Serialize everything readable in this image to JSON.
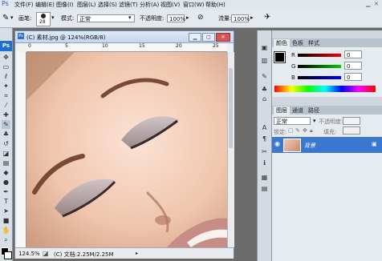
{
  "menu": [
    "文件(F)",
    "编辑(E)",
    "图像(I)",
    "图层(L)",
    "选择(S)",
    "滤镜(T)",
    "分析(A)",
    "视图(V)",
    "窗口(W)",
    "帮助(H)"
  ],
  "options": {
    "brush_label": "画笔:",
    "brush_size": "28",
    "mode_label": "模式:",
    "mode_value": "正常",
    "opacity_label": "不透明度:",
    "opacity_value": "100%",
    "flow_label": "流量:",
    "flow_value": "100%"
  },
  "document": {
    "title": "(C) 素材.jpg @ 124%(RGB/8)",
    "zoom": "124.5%",
    "doc_size": "(C) 文档:2.25M/2.25M",
    "ruler_marks": [
      "0",
      "5",
      "10",
      "15",
      "20",
      "25"
    ]
  },
  "color_panel": {
    "tabs": [
      "颜色",
      "色板",
      "样式"
    ],
    "channels": [
      {
        "label": "R",
        "value": "0"
      },
      {
        "label": "G",
        "value": "0"
      },
      {
        "label": "B",
        "value": "0"
      }
    ]
  },
  "layers_panel": {
    "tabs": [
      "图层",
      "通道",
      "路径"
    ],
    "blend_mode": "正常",
    "opacity_label": "不透明度:",
    "lock_label": "锁定:",
    "fill_label": "填充:",
    "layer_name": "背景"
  },
  "toolbox": {
    "logo": "Ps"
  },
  "colors": {
    "accent": "#3a77d0",
    "menubar": "#dfe6ee",
    "workspace": "#6b6b6b"
  }
}
